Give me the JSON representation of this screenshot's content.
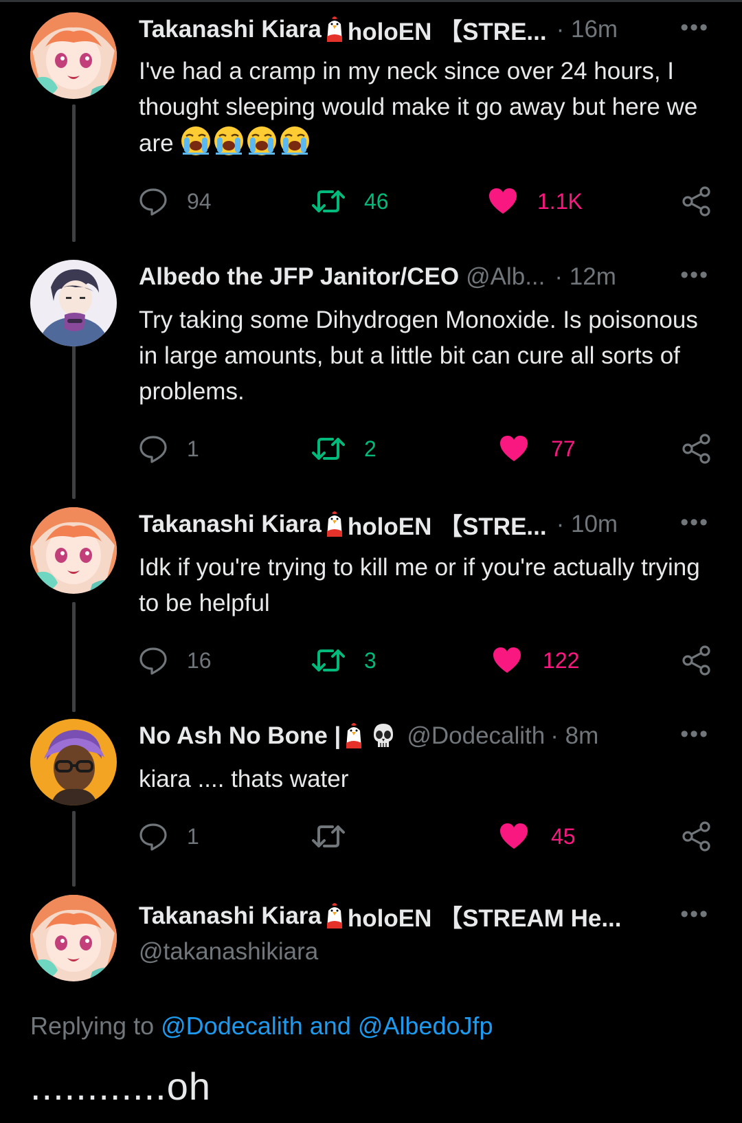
{
  "colors": {
    "background": "#000000",
    "text": "#e7e9ea",
    "muted": "#71767b",
    "retweet": "#00ba7c",
    "like": "#f91880",
    "link": "#1d9bf0"
  },
  "icons": {
    "reply": "speech-bubble-icon",
    "retweet": "retweet-arrows-icon",
    "like": "heart-icon",
    "share": "share-nodes-icon",
    "more": "ellipsis-icon",
    "name_emoji": "chicken-emoji",
    "skull": "skull-emoji",
    "crying": "loudly-crying-face-emoji"
  },
  "tweets": [
    {
      "name": "Takanashi Kiara",
      "name_suffix": "holoEN 【STRE...",
      "handle": "",
      "time": "· 16m",
      "more": "•••",
      "text": "I've had a cramp in my neck since over 24 hours, I thought sleeping would make it go away but here we are",
      "emoji_count": 4,
      "replies": "94",
      "retweets": "46",
      "likes": "1.1K"
    },
    {
      "name": "Albedo the JFP Janitor/CEO",
      "handle": "@Alb...",
      "time": "· 12m",
      "more": "•••",
      "text": "Try taking some Dihydrogen Monoxide. Is poisonous in large amounts, but a little bit can cure all sorts of problems.",
      "replies": "1",
      "retweets": "2",
      "likes": "77"
    },
    {
      "name": "Takanashi Kiara",
      "name_suffix": "holoEN 【STRE...",
      "handle": "",
      "time": "· 10m",
      "more": "•••",
      "text": "Idk if you're trying to kill me or if you're actually trying to be helpful",
      "replies": "16",
      "retweets": "3",
      "likes": "122"
    },
    {
      "name": "No Ash No Bone |",
      "handle": "@Dodecalith",
      "time": "· 8m",
      "more": "•••",
      "text": "kiara .... thats water",
      "replies": "1",
      "retweets": "",
      "likes": "45"
    },
    {
      "name": "Takanashi Kiara",
      "name_suffix": "holoEN 【STREAM He...",
      "handle": "@takanashikiara",
      "more": "•••"
    }
  ],
  "replying": {
    "prefix": "Replying to",
    "links": "@Dodecalith and @AlbedoJfp"
  },
  "final_text": "............oh"
}
